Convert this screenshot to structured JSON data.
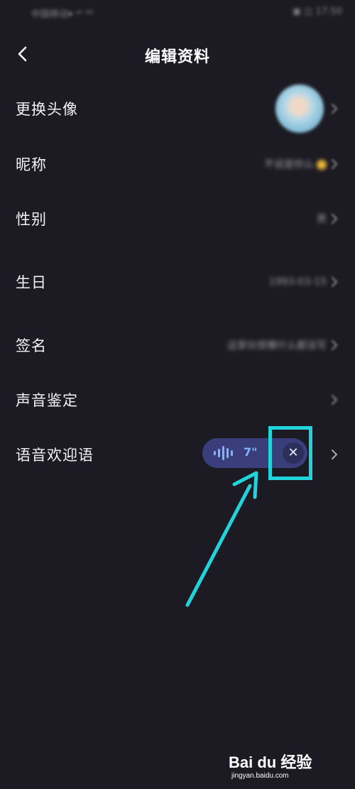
{
  "status_bar": {
    "left": "中国移动▾ ᵃˡˡ ⁴ᴳ",
    "right": "▣ ◫ 17:50"
  },
  "header": {
    "title": "编辑资料",
    "back_icon": "chevron-left-icon"
  },
  "rows": [
    {
      "label": "更换头像",
      "value": ""
    },
    {
      "label": "昵称",
      "value": "不说是你么"
    },
    {
      "label": "性别",
      "value": "男"
    },
    {
      "label": "生日",
      "value": "1993-03-15"
    },
    {
      "label": "签名",
      "value": "这家伙很懒什么都没写"
    },
    {
      "label": "声音鉴定",
      "value": ""
    },
    {
      "label": "语音欢迎语",
      "value": ""
    }
  ],
  "voice_greeting": {
    "duration": "7\"",
    "wave_icon": "sound-wave-icon",
    "close_icon": "close-icon"
  },
  "watermark": {
    "logo": "Bai du 经验",
    "url": "jingyan.baidu.com"
  },
  "colors": {
    "background": "#1c1b23",
    "pill": "#3a3f7c",
    "accent": "#22d3dc",
    "duration_text": "#7fb3ff"
  }
}
